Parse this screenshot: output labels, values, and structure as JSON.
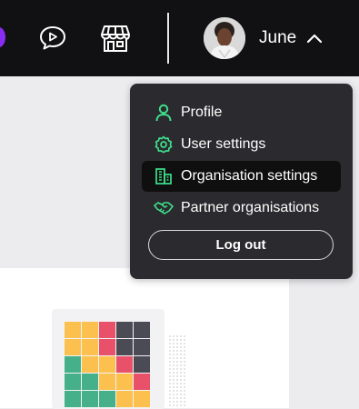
{
  "header": {
    "user_name": "June"
  },
  "account_menu": {
    "items": [
      {
        "label": "Profile",
        "icon": "user-icon"
      },
      {
        "label": "User settings",
        "icon": "gear-icon"
      },
      {
        "label": "Organisation settings",
        "icon": "building-icon"
      },
      {
        "label": "Partner organisations",
        "icon": "handshake-icon"
      }
    ],
    "active_item": "Organisation settings",
    "logout_label": "Log out"
  },
  "colors": {
    "topbar": "#111113",
    "menu_bg": "#2b2b2f",
    "accent_green": "#3ee08b",
    "tile_yellow": "#fbc04d",
    "tile_red": "#e9506a",
    "tile_gray": "#4b4b55",
    "tile_teal": "#46b08a"
  },
  "tile_grid": [
    [
      "yellow",
      "yellow",
      "red",
      "gray",
      "gray"
    ],
    [
      "yellow",
      "yellow",
      "red",
      "gray",
      "gray"
    ],
    [
      "teal",
      "yellow",
      "yellow",
      "red",
      "gray"
    ],
    [
      "teal",
      "teal",
      "yellow",
      "yellow",
      "red"
    ],
    [
      "teal",
      "teal",
      "teal",
      "yellow",
      "yellow"
    ]
  ]
}
